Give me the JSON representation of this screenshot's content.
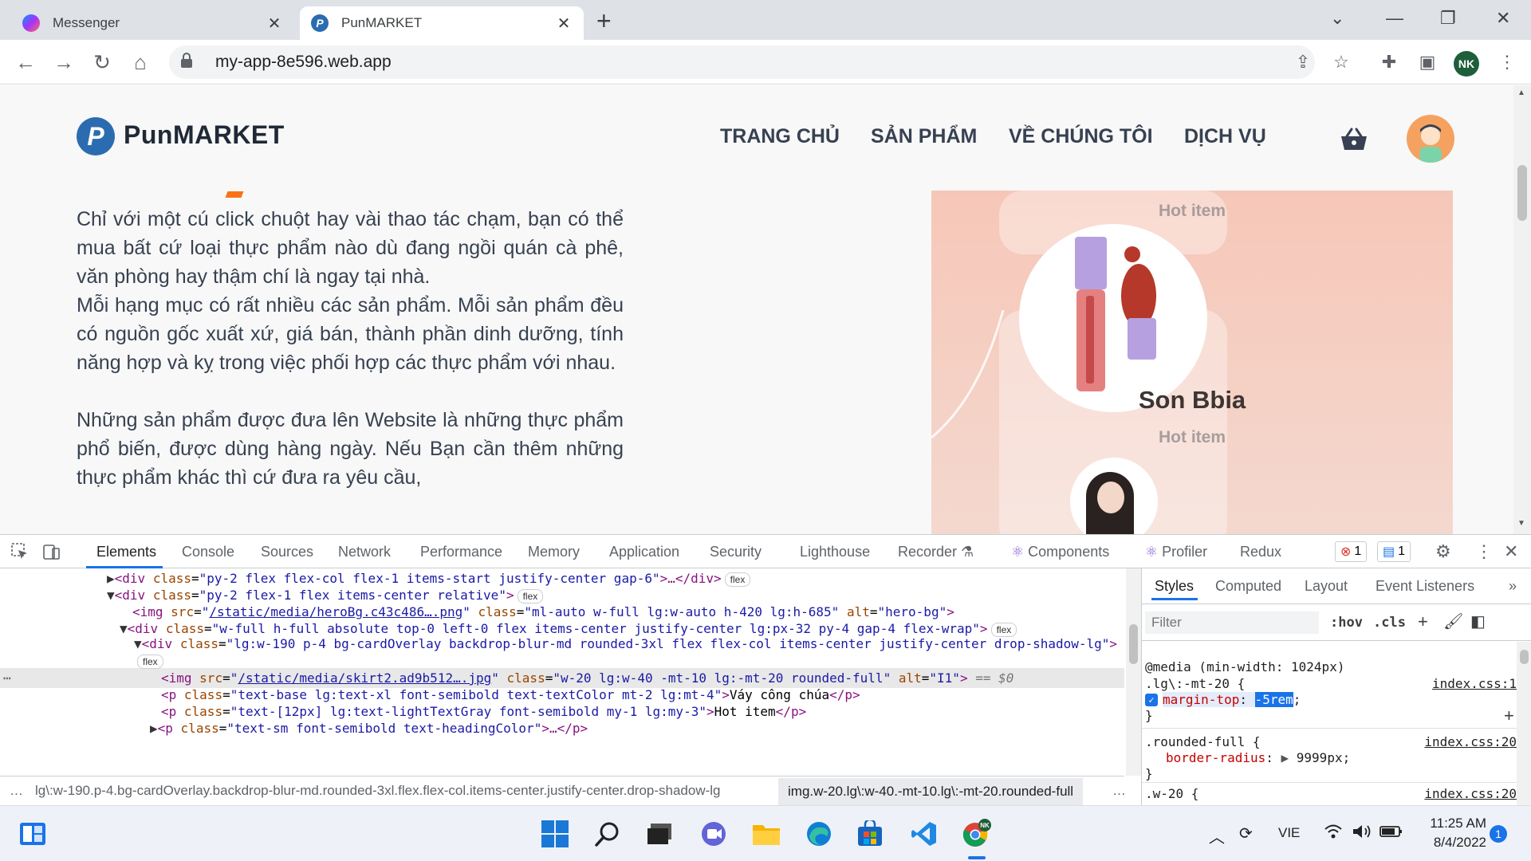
{
  "browser": {
    "tabs": [
      {
        "label": "Messenger",
        "active": false
      },
      {
        "label": "PunMARKET",
        "active": true
      }
    ],
    "new_tab": "+",
    "url": "my-app-8e596.web.app",
    "profile_initials": "NK"
  },
  "page": {
    "brand": "PunMARKET",
    "brand_letter": "P",
    "nav": [
      "TRANG CHỦ",
      "SẢN PHẨM",
      "VỀ CHÚNG TÔI",
      "DỊCH VỤ"
    ],
    "paragraphs": [
      "Chỉ với một cú click chuột hay vài thao tác chạm, bạn có thể mua bất cứ loại thực phẩm nào dù đang ngồi quán cà phê, văn phòng hay thậm chí là ngay tại nhà.",
      "Mỗi hạng mục có rất nhiều các sản phẩm. Mỗi sản phẩm đều có nguồn gốc xuất xứ, giá bán, thành phần dinh dưỡng, tính năng hợp và kỵ trong việc phối hợp các thực phẩm với nhau.",
      "Những sản phẩm được đưa lên Website là những thực phẩm phổ biến, được dùng hàng ngày. Nếu Bạn cần thêm những thực phẩm khác thì cứ đưa ra yêu cầu,"
    ],
    "hero": {
      "hot_label": "Hot item",
      "product_name": "Son Bbia"
    }
  },
  "devtools": {
    "tabs": [
      "Elements",
      "Console",
      "Sources",
      "Network",
      "Performance",
      "Memory",
      "Application",
      "Security",
      "Lighthouse",
      "Recorder",
      "Components",
      "Profiler",
      "Redux"
    ],
    "active_tab": "Elements",
    "error_count": "1",
    "message_count": "1",
    "dom_lines": [
      {
        "tag": "div",
        "cls": "py-2 flex flex-col flex-1 items-start justify-center gap-6",
        "suffix": ">…</div>",
        "badge": "flex"
      },
      {
        "tag": "div",
        "cls": "py-2 flex-1 flex items-center relative",
        "suffix": ">",
        "badge": "flex"
      },
      {
        "img_src": "/static/media/heroBg.c43c486….png",
        "img_cls": "ml-auto w-full lg:w-auto h-420 lg:h-685",
        "alt": "hero-bg"
      },
      {
        "tag": "div",
        "cls": "w-full h-full absolute top-0 left-0 flex items-center justify-center lg:px-32 py-4 gap-4 flex-wrap",
        "suffix": ">",
        "badge": "flex"
      },
      {
        "tag": "div",
        "cls": "lg:w-190 p-4 bg-cardOverlay backdrop-blur-md rounded-3xl flex flex-col items-center justify-center drop-shadow-lg",
        "suffix": ">",
        "badge": "flex"
      },
      {
        "img_src": "/static/media/skirt2.ad9b512….jpg",
        "img_cls": "w-20 lg:w-40 -mt-10 lg:-mt-20 rounded-full",
        "alt": "I1",
        "eq": "== $0"
      },
      {
        "tag": "p",
        "cls": "text-base lg:text-xl font-semibold text-textColor mt-2 lg:mt-4",
        "text": "Váy công chúa"
      },
      {
        "tag": "p",
        "cls": "text-[12px] lg:text-lightTextGray font-semibold my-1 lg:my-3",
        "text": "Hot item"
      },
      {
        "tag": "p",
        "cls": "text-sm font-semibold text-headingColor",
        "suffix": ">…</p>"
      }
    ],
    "breadcrumbs": [
      "lg\\:w-190.p-4.bg-cardOverlay.backdrop-blur-md.rounded-3xl.flex.flex-col.items-center.justify-center.drop-shadow-lg",
      "img.w-20.lg\\:w-40.-mt-10.lg\\:-mt-20.rounded-full"
    ],
    "styles": {
      "tabs": [
        "Styles",
        "Computed",
        "Layout",
        "Event Listeners"
      ],
      "filter_placeholder": "Filter",
      "hov": ":hov",
      "cls": ".cls",
      "media": "@media (min-width: 1024px)",
      "rule1_selector": ".lg\\:-mt-20 {",
      "rule1_source": "index.css:1",
      "rule1_prop": "margin-top",
      "rule1_value": "-5rem",
      "rule2_selector": ".rounded-full {",
      "rule2_source": "index.css:20",
      "rule2_prop": "border-radius",
      "rule2_value": "9999px",
      "rule3_selector": ".w-20 {",
      "rule3_source": "index.css:20"
    }
  },
  "taskbar": {
    "language": "VIE",
    "time": "11:25 AM",
    "date": "8/4/2022",
    "notification_count": "1"
  }
}
